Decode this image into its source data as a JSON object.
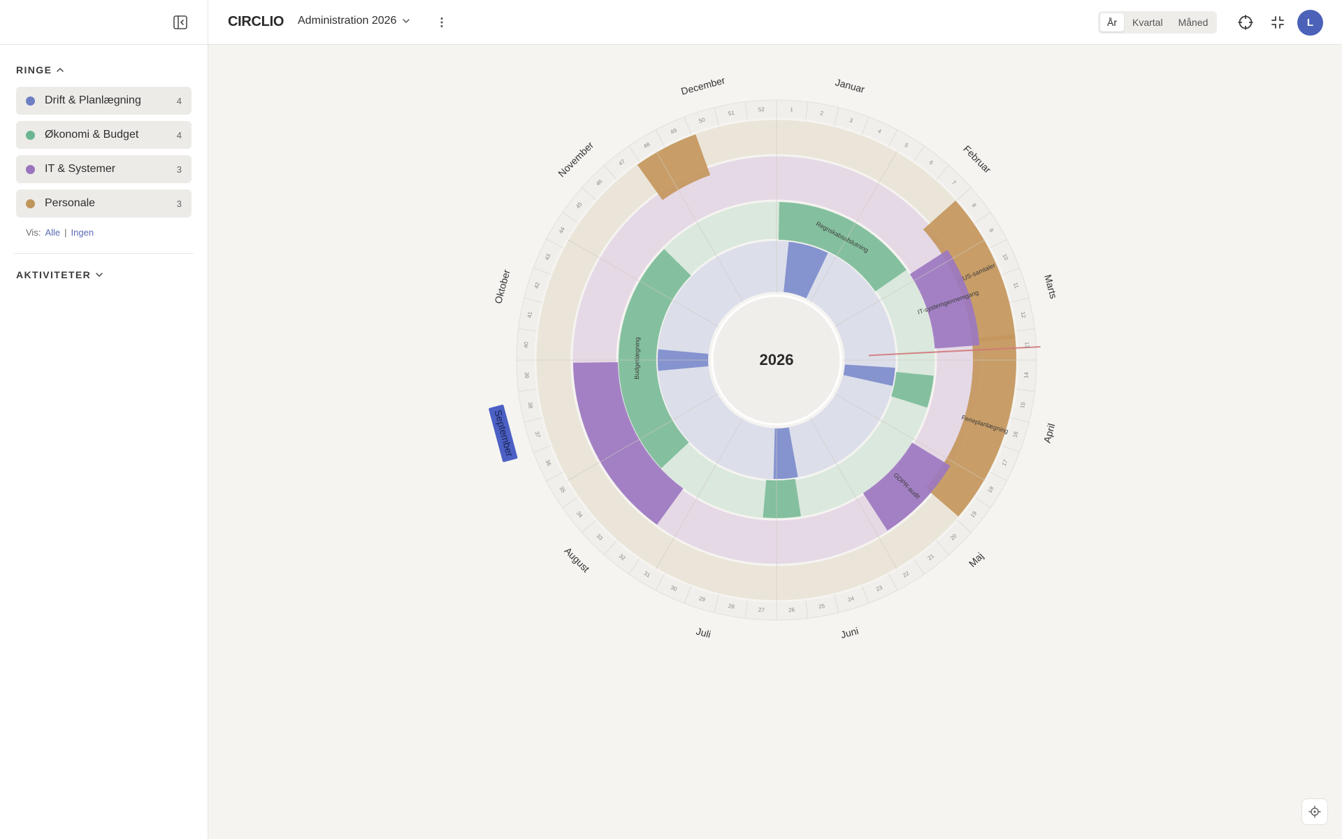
{
  "app": {
    "brand": "CIRCLIO",
    "wheel_name": "Administration 2026"
  },
  "header": {
    "views": [
      {
        "label": "År",
        "active": true
      },
      {
        "label": "Kvartal",
        "active": false
      },
      {
        "label": "Måned",
        "active": false
      }
    ],
    "avatar_initial": "L"
  },
  "sidebar": {
    "rings_heading": "RINGE",
    "rings": [
      {
        "label": "Drift & Planlægning",
        "count": "4",
        "color": "#6f7fc4"
      },
      {
        "label": "Økonomi & Budget",
        "count": "4",
        "color": "#6bb592"
      },
      {
        "label": "IT & Systemer",
        "count": "3",
        "color": "#9a74bd"
      },
      {
        "label": "Personale",
        "count": "3",
        "color": "#c0955a"
      }
    ],
    "show_label": "Vis:",
    "show_all": "Alle",
    "show_separator": "|",
    "show_none": "Ingen",
    "activities_heading": "AKTIVITETER"
  },
  "wheel": {
    "year": "2026",
    "months": [
      "Januar",
      "Februar",
      "Marts",
      "April",
      "Maj",
      "Juni",
      "Juli",
      "August",
      "September",
      "Oktober",
      "November",
      "December"
    ],
    "highlighted_month": "September",
    "weeks": 52,
    "today_fraction": 0.242,
    "ring_fills": {
      "personale": "#ebe5d9",
      "it": "#e6d9e6",
      "okonomi": "#dbe8dd",
      "drift": "#dcdfea"
    },
    "activities": [
      {
        "ring": "personale",
        "start": 0.1342,
        "end": 0.2356,
        "label": "MUS-samtaler",
        "color": "#c4975d"
      },
      {
        "ring": "personale",
        "start": 0.2329,
        "end": 0.363,
        "label": "Ferieplanlægning",
        "color": "#c4975d"
      },
      {
        "ring": "personale",
        "start": 0.9014,
        "end": 0.9452,
        "label": "",
        "color": "#c4975d"
      },
      {
        "ring": "it",
        "start": 0.1589,
        "end": 0.2384,
        "label": "IT-systemgennemgang",
        "color": "#9c78c0"
      },
      {
        "ring": "it",
        "start": 0.337,
        "end": 0.4082,
        "label": "GDPR-audit",
        "color": "#9c78c0"
      },
      {
        "ring": "it",
        "start": 0.6,
        "end": 0.7479,
        "label": "",
        "color": "#9c78c0"
      },
      {
        "ring": "okonomi",
        "start": 0.0027,
        "end": 0.1534,
        "label": "Regnskabsafslutning",
        "color": "#7dbc99"
      },
      {
        "ring": "okonomi",
        "start": 0.2658,
        "end": 0.2986,
        "label": "",
        "color": "#7dbc99"
      },
      {
        "ring": "okonomi",
        "start": 0.4753,
        "end": 0.5137,
        "label": "",
        "color": "#7dbc99"
      },
      {
        "ring": "okonomi",
        "start": 0.6301,
        "end": 0.874,
        "label": "Budgetlægning",
        "color": "#7dbc99"
      },
      {
        "ring": "drift",
        "start": 0.0164,
        "end": 0.0712,
        "label": "",
        "color": "#7d8ccc"
      },
      {
        "ring": "drift",
        "start": 0.2603,
        "end": 0.2849,
        "label": "",
        "color": "#7d8ccc"
      },
      {
        "ring": "drift",
        "start": 0.4712,
        "end": 0.5041,
        "label": "",
        "color": "#7d8ccc"
      },
      {
        "ring": "drift",
        "start": 0.7356,
        "end": 0.7644,
        "label": "",
        "color": "#7d8ccc"
      }
    ]
  }
}
